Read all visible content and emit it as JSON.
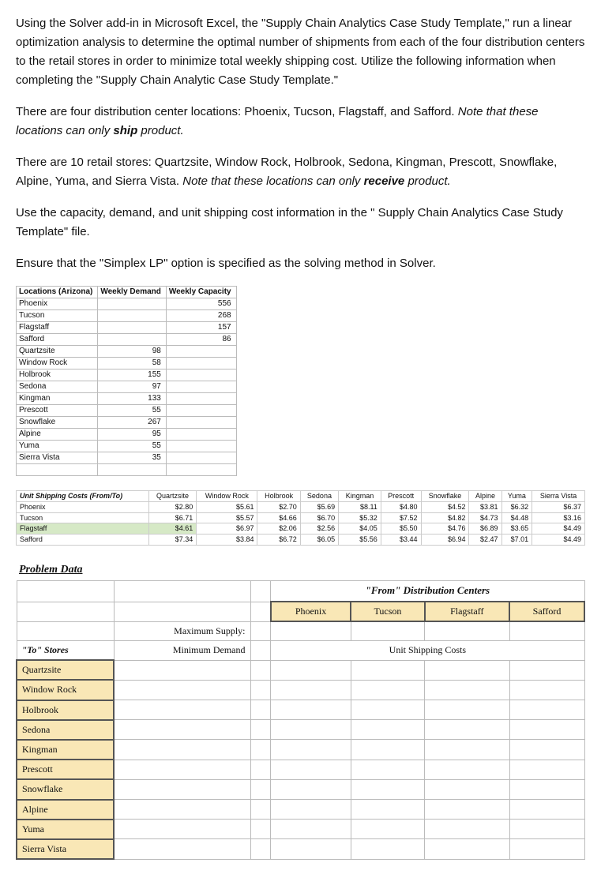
{
  "paragraphs": {
    "p1": "Using the Solver add-in in Microsoft Excel, the \"Supply Chain Analytics Case Study Template,\" run a linear optimization analysis to determine the optimal number of shipments from each of the four distribution centers to the retail stores in order to minimize total weekly shipping cost. Utilize the following information when completing the \"Supply Chain Analytic Case Study Template.\"",
    "p2a": "There are four distribution center locations: Phoenix, Tucson, Flagstaff, and Safford. ",
    "p2b_italic_prefix": "Note that these locations can only ",
    "p2b_bold": "ship",
    "p2b_italic_suffix": " product.",
    "p3a": "There are 10 retail stores: Quartzsite, Window Rock, Holbrook, Sedona, Kingman, Prescott, Snowflake, Alpine, Yuma, and Sierra Vista. ",
    "p3b_italic_prefix": "Note that these locations can only ",
    "p3b_bold": "receive",
    "p3b_italic_suffix": " product.",
    "p4": "Use the capacity, demand, and unit shipping cost information in the \" Supply Chain Analytics Case Study Template\" file.",
    "p5": "Ensure that the \"Simplex LP\" option is specified as the solving method in Solver."
  },
  "locations_table": {
    "headers": [
      "Locations (Arizona)",
      "Weekly Demand",
      "Weekly Capacity"
    ],
    "rows": [
      {
        "name": "Phoenix",
        "demand": "",
        "capacity": "556"
      },
      {
        "name": "Tucson",
        "demand": "",
        "capacity": "268"
      },
      {
        "name": "Flagstaff",
        "demand": "",
        "capacity": "157"
      },
      {
        "name": "Safford",
        "demand": "",
        "capacity": "86"
      },
      {
        "name": "Quartzsite",
        "demand": "98",
        "capacity": ""
      },
      {
        "name": "Window Rock",
        "demand": "58",
        "capacity": ""
      },
      {
        "name": "Holbrook",
        "demand": "155",
        "capacity": ""
      },
      {
        "name": "Sedona",
        "demand": "97",
        "capacity": ""
      },
      {
        "name": "Kingman",
        "demand": "133",
        "capacity": ""
      },
      {
        "name": "Prescott",
        "demand": "55",
        "capacity": ""
      },
      {
        "name": "Snowflake",
        "demand": "267",
        "capacity": ""
      },
      {
        "name": "Alpine",
        "demand": "95",
        "capacity": ""
      },
      {
        "name": "Yuma",
        "demand": "55",
        "capacity": ""
      },
      {
        "name": "Sierra Vista",
        "demand": "35",
        "capacity": ""
      }
    ]
  },
  "costs_table": {
    "title": "Unit Shipping Costs (From/To)",
    "cols": [
      "Quartzsite",
      "Window Rock",
      "Holbrook",
      "Sedona",
      "Kingman",
      "Prescott",
      "Snowflake",
      "Alpine",
      "Yuma",
      "Sierra Vista"
    ],
    "rows": [
      {
        "name": "Phoenix",
        "vals": [
          "$2.80",
          "$5.61",
          "$2.70",
          "$5.69",
          "$8.11",
          "$4.80",
          "$4.52",
          "$3.81",
          "$6.32",
          "$6.37"
        ]
      },
      {
        "name": "Tucson",
        "vals": [
          "$6.71",
          "$5.57",
          "$4.66",
          "$6.70",
          "$5.32",
          "$7.52",
          "$4.82",
          "$4.73",
          "$4.48",
          "$3.16"
        ]
      },
      {
        "name": "Flagstaff",
        "vals": [
          "$4.61",
          "$6.97",
          "$2.06",
          "$2.56",
          "$4.05",
          "$5.50",
          "$4.76",
          "$6.89",
          "$3.65",
          "$4.49"
        ],
        "hl": [
          0,
          1
        ]
      },
      {
        "name": "Safford",
        "vals": [
          "$7.34",
          "$3.84",
          "$6.72",
          "$6.05",
          "$5.56",
          "$3.44",
          "$6.94",
          "$2.47",
          "$7.01",
          "$4.49"
        ]
      }
    ]
  },
  "problem_data": {
    "heading": "Problem Data",
    "from_label": "\"From\" Distribution Centers",
    "dc": [
      "Phoenix",
      "Tucson",
      "Flagstaff",
      "Safford"
    ],
    "max_supply": "Maximum Supply:",
    "to_label": "\"To\" Stores",
    "min_demand": "Minimum Demand",
    "usc": "Unit Shipping Costs",
    "stores": [
      "Quartzsite",
      "Window Rock",
      "Holbrook",
      "Sedona",
      "Kingman",
      "Prescott",
      "Snowflake",
      "Alpine",
      "Yuma",
      "Sierra Vista"
    ]
  }
}
